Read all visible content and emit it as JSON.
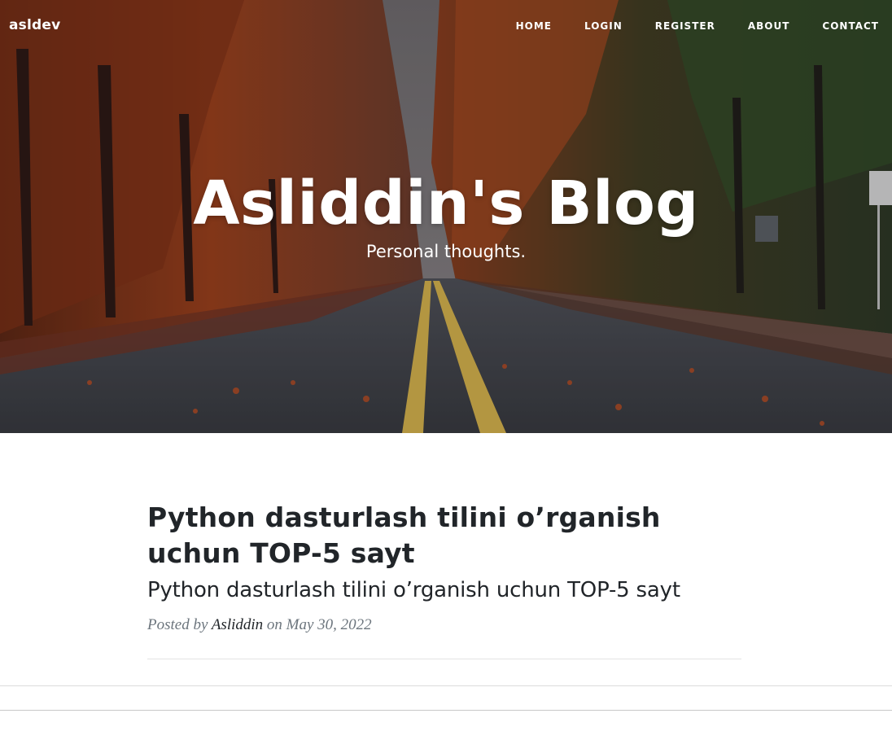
{
  "nav": {
    "brand": "asldev",
    "links": [
      {
        "label": "HOME"
      },
      {
        "label": "LOGIN"
      },
      {
        "label": "REGISTER"
      },
      {
        "label": "ABOUT"
      },
      {
        "label": "CONTACT"
      }
    ]
  },
  "hero": {
    "title": "Asliddin's Blog",
    "subtitle": "Personal thoughts.",
    "image": "autumn-forest-road-photo"
  },
  "posts": [
    {
      "title": "Python dasturlash tilini o’rganish uchun TOP-5 sayt",
      "subtitle": "Python dasturlash tilini o’rganish uchun TOP-5 sayt",
      "meta_prefix": "Posted by",
      "author": "Asliddin",
      "meta_on": "on",
      "date": "May 30, 2022"
    }
  ],
  "colors": {
    "text_dark": "#212529",
    "text_muted": "#6c757d",
    "nav_text": "#ffffff"
  }
}
